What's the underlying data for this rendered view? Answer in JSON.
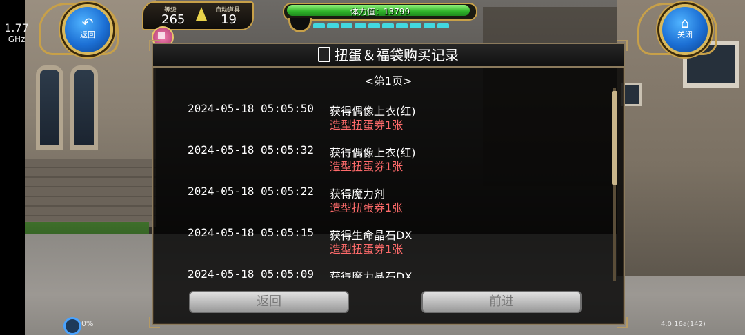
{
  "status": {
    "cpu_value": "1.77",
    "cpu_unit": "GHz"
  },
  "hud": {
    "back_button": {
      "label": "返回",
      "icon": "undo-arrow-icon"
    },
    "close_button": {
      "label": "关闭",
      "icon": "home-icon"
    },
    "level_label": "等级",
    "level_value": "265",
    "auto_item_label": "自动道具",
    "auto_item_value": "19",
    "stamina_text": "体力值：13799",
    "stamina_fill": 0.98,
    "gift_icon": "gift-icon"
  },
  "dialog": {
    "title": "扭蛋＆福袋购买记录",
    "page_label": "<第1页>",
    "records": [
      {
        "timestamp": "2024-05-18 05:05:50",
        "item": "获得偶像上衣(红)",
        "cost": "造型扭蛋券1张"
      },
      {
        "timestamp": "2024-05-18 05:05:32",
        "item": "获得偶像上衣(红)",
        "cost": "造型扭蛋券1张"
      },
      {
        "timestamp": "2024-05-18 05:05:22",
        "item": "获得魔力剂",
        "cost": "造型扭蛋券1张"
      },
      {
        "timestamp": "2024-05-18 05:05:15",
        "item": "获得生命晶石DX",
        "cost": "造型扭蛋券1张"
      },
      {
        "timestamp": "2024-05-18 05:05:09",
        "item": "获得魔力晶石DX",
        "cost": ""
      }
    ],
    "back_label": "返回",
    "next_label": "前进"
  },
  "footer": {
    "load_percent": "0%",
    "version": "4.0.16a(142)"
  },
  "colors": {
    "cost_text": "#ff6b6b",
    "frame_gold": "#c7a049",
    "button_blue": "#1c6fd4"
  }
}
